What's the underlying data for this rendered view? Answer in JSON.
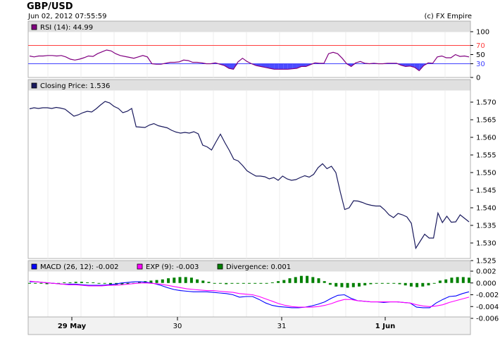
{
  "header": {
    "symbol": "GBP/USD",
    "timestamp": "Jun 02, 2012 07:55:59",
    "credit": "(c) FX Empire"
  },
  "colors": {
    "panel_bg": "#e0e0e0",
    "plot_border": "#b0b0b0",
    "grid": "#ececec",
    "rsi_line": "#800080",
    "rsi_fill": "#4b4bff",
    "rsi_upper": "#ff4040",
    "rsi_lower": "#4040ff",
    "price_line": "#1a1a5e",
    "macd_line": "#0000ff",
    "exp_line": "#ff00ff",
    "divergence": "#008000"
  },
  "chart_data": [
    {
      "type": "line",
      "panel": "rsi",
      "legend": "RSI (14): 44.99",
      "legend_swatch_color": "#800080",
      "ylim": [
        0,
        100
      ],
      "yticks": [
        "100",
        "70",
        "50",
        "30",
        "0"
      ],
      "ytick_values": [
        100,
        70,
        50,
        30,
        0
      ],
      "reference_lines": [
        {
          "value": 70,
          "color": "#ff4040"
        },
        {
          "value": 30,
          "color": "#4040ff"
        }
      ],
      "series": [
        {
          "values": [
            47,
            45,
            47,
            47,
            48,
            48,
            47,
            48,
            45,
            40,
            38,
            40,
            43,
            47,
            46,
            52,
            56,
            60,
            58,
            52,
            48,
            46,
            44,
            42,
            45,
            48,
            45,
            30,
            29,
            29,
            31,
            33,
            33,
            34,
            38,
            37,
            33,
            33,
            32,
            30,
            30,
            32,
            29,
            26,
            20,
            18,
            34,
            42,
            35,
            30,
            26,
            24,
            22,
            20,
            18,
            18,
            18,
            18,
            19,
            20,
            24,
            24,
            28,
            32,
            31,
            31,
            52,
            55,
            52,
            42,
            30,
            24,
            32,
            35,
            31,
            30,
            31,
            30,
            30,
            31,
            31,
            31,
            27,
            24,
            25,
            22,
            15,
            26,
            32,
            31,
            45,
            47,
            43,
            43,
            50,
            46,
            47,
            45
          ]
        }
      ]
    },
    {
      "type": "line",
      "panel": "price",
      "legend": "Closing Price: 1.536",
      "legend_swatch_color": "#1a1a5e",
      "ylim": [
        1.525,
        1.572
      ],
      "yticks": [
        "1.570",
        "1.565",
        "1.560",
        "1.555",
        "1.550",
        "1.545",
        "1.540",
        "1.535",
        "1.530",
        "1.525"
      ],
      "ytick_values": [
        1.57,
        1.565,
        1.56,
        1.555,
        1.55,
        1.545,
        1.54,
        1.535,
        1.53,
        1.525
      ],
      "series": [
        {
          "values": [
            1.5681,
            1.5684,
            1.5682,
            1.5684,
            1.5684,
            1.5682,
            1.5685,
            1.5683,
            1.568,
            1.567,
            1.566,
            1.5664,
            1.567,
            1.5674,
            1.5672,
            1.5681,
            1.5692,
            1.5702,
            1.5698,
            1.5688,
            1.5682,
            1.567,
            1.5674,
            1.5682,
            1.563,
            1.5629,
            1.5628,
            1.5635,
            1.5639,
            1.5633,
            1.563,
            1.5627,
            1.562,
            1.5615,
            1.5612,
            1.5614,
            1.5612,
            1.5616,
            1.561,
            1.5578,
            1.5573,
            1.5564,
            1.5587,
            1.5609,
            1.5585,
            1.5563,
            1.5538,
            1.5533,
            1.552,
            1.5505,
            1.5497,
            1.549,
            1.549,
            1.5488,
            1.5482,
            1.5486,
            1.5478,
            1.549,
            1.5482,
            1.5478,
            1.548,
            1.5486,
            1.5491,
            1.5487,
            1.5495,
            1.5514,
            1.5525,
            1.5511,
            1.5518,
            1.55,
            1.5445,
            1.5395,
            1.54,
            1.542,
            1.5419,
            1.5415,
            1.541,
            1.5407,
            1.5405,
            1.5405,
            1.5394,
            1.538,
            1.5372,
            1.5384,
            1.538,
            1.5374,
            1.5356,
            1.5285,
            1.5305,
            1.5325,
            1.5314,
            1.5314,
            1.5385,
            1.5358,
            1.5376,
            1.5359,
            1.536,
            1.538,
            1.537,
            1.536
          ]
        }
      ]
    },
    {
      "type": "line",
      "panel": "macd",
      "legend": [
        "MACD (26, 12): -0.002",
        "EXP (9): -0.003",
        "Divergence: 0.001"
      ],
      "legend_swatch_colors": [
        "#0000ff",
        "#ff00ff",
        "#008000"
      ],
      "ylim": [
        -0.006,
        0.002
      ],
      "yticks": [
        "0.002",
        "0.000",
        "-0.002",
        "-0.004",
        "-0.006"
      ],
      "ytick_values": [
        0.002,
        0.0,
        -0.002,
        -0.004,
        -0.006
      ],
      "series": [
        {
          "name": "MACD (26, 12)",
          "values": [
            0.0002,
            0.0002,
            0.0001,
            0.0,
            -0.0001,
            -0.0002,
            -0.0002,
            -0.0002,
            -0.0003,
            -0.0004,
            -0.0004,
            -0.0004,
            -0.0003,
            -0.0002,
            0.0,
            0.0001,
            0.0002,
            0.0002,
            0.0001,
            -0.0001,
            -0.0004,
            -0.0008,
            -0.0011,
            -0.0013,
            -0.0014,
            -0.0015,
            -0.0015,
            -0.0015,
            -0.0016,
            -0.0017,
            -0.0018,
            -0.002,
            -0.0024,
            -0.0023,
            -0.0023,
            -0.0028,
            -0.0034,
            -0.0038,
            -0.004,
            -0.0041,
            -0.0042,
            -0.0042,
            -0.0041,
            -0.0039,
            -0.0036,
            -0.0032,
            -0.0026,
            -0.0021,
            -0.002,
            -0.0026,
            -0.003,
            -0.0031,
            -0.0032,
            -0.0032,
            -0.0033,
            -0.0032,
            -0.0032,
            -0.0033,
            -0.0034,
            -0.0041,
            -0.0042,
            -0.0042,
            -0.0034,
            -0.0028,
            -0.0023,
            -0.0022,
            -0.0018,
            -0.0015
          ]
        },
        {
          "name": "EXP (9)",
          "values": [
            0.0003,
            0.0002,
            0.0001,
            0.0,
            -0.0001,
            -0.0002,
            -0.0003,
            -0.0003,
            -0.0004,
            -0.0005,
            -0.0005,
            -0.0005,
            -0.0004,
            -0.0004,
            -0.0003,
            -0.0002,
            -0.0001,
            0.0,
            0.0,
            -0.0001,
            -0.0002,
            -0.0004,
            -0.0006,
            -0.0008,
            -0.001,
            -0.0011,
            -0.0012,
            -0.0013,
            -0.0013,
            -0.0014,
            -0.0015,
            -0.0016,
            -0.0018,
            -0.0019,
            -0.002,
            -0.0023,
            -0.0027,
            -0.0031,
            -0.0035,
            -0.0038,
            -0.004,
            -0.0041,
            -0.0041,
            -0.0041,
            -0.004,
            -0.0038,
            -0.0035,
            -0.0031,
            -0.0028,
            -0.0028,
            -0.003,
            -0.0031,
            -0.0032,
            -0.0032,
            -0.0032,
            -0.0032,
            -0.0032,
            -0.0033,
            -0.0034,
            -0.0037,
            -0.0039,
            -0.004,
            -0.0039,
            -0.0037,
            -0.0033,
            -0.003,
            -0.0027,
            -0.0024
          ]
        },
        {
          "name": "Divergence",
          "values": [
            0.0,
            0.0,
            -0.0001,
            -0.0002,
            -0.0001,
            0.0,
            0.0001,
            0.0001,
            0.0002,
            0.0002,
            0.0001,
            0.0001,
            0.0,
            -0.0001,
            -0.0002,
            -0.0003,
            -0.0003,
            -0.0002,
            0.0,
            0.0002,
            0.0003,
            0.0004,
            0.0005,
            0.0006,
            0.0008,
            0.0009,
            0.001,
            0.001,
            0.0009,
            0.0006,
            0.0004,
            0.0002,
            0.0,
            -0.0001,
            -0.0002,
            -0.0001,
            0.0,
            0.0,
            -0.0001,
            -0.0001,
            -0.0001,
            0.0,
            0.0001,
            0.0003,
            0.0005,
            0.0008,
            0.001,
            0.0012,
            0.0012,
            0.001,
            0.0008,
            0.0003,
            -0.0003,
            -0.0006,
            -0.0007,
            -0.0008,
            -0.0007,
            -0.0006,
            -0.0004,
            -0.0002,
            -0.0001,
            0.0,
            0.0,
            -0.0001,
            -0.0002,
            -0.0004,
            -0.0006,
            -0.0007,
            -0.0006,
            -0.0004,
            0.0,
            0.0004,
            0.0006,
            0.0009,
            0.001,
            0.001,
            0.0009
          ]
        }
      ]
    }
  ],
  "x_axis": {
    "labels": [
      "29 May",
      "30",
      "31",
      "1 Jun"
    ],
    "bold": [
      true,
      false,
      false,
      true
    ]
  }
}
